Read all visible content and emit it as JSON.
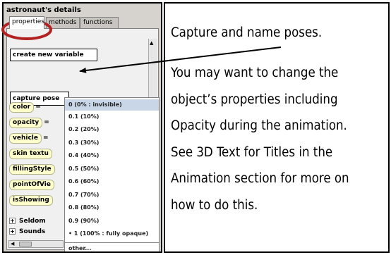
{
  "panel": {
    "title": "astronaut's details",
    "tabs": [
      "properties",
      "methods",
      "functions"
    ],
    "buttons": {
      "new_variable": "create new variable",
      "capture_pose": "capture pose"
    },
    "properties": [
      {
        "name": "color",
        "suffix": "="
      },
      {
        "name": "opacity",
        "suffix": "="
      },
      {
        "name": "vehicle",
        "suffix": "="
      },
      {
        "name": "skin textu",
        "suffix": ""
      },
      {
        "name": "fillingStyle",
        "suffix": ""
      },
      {
        "name": "pointOfVie",
        "suffix": ""
      },
      {
        "name": "isShowing",
        "suffix": ""
      }
    ],
    "tree": [
      {
        "symbol": "+",
        "label": "Seldom"
      },
      {
        "symbol": "+",
        "label": "Sounds"
      }
    ]
  },
  "dropdown": {
    "options": [
      "0 (0% : invisible)",
      "0.1 (10%)",
      "0.2 (20%)",
      "0.3 (30%)",
      "0.4 (40%)",
      "0.5 (50%)",
      "0.6 (60%)",
      "0.7 (70%)",
      "0.8 (80%)",
      "0.9 (90%)",
      "• 1 (100% : fully opaque)"
    ],
    "other": "other...",
    "selected_index": 0
  },
  "note": {
    "lines": [
      "Capture and name poses.",
      "You  may want to change the",
      "object’s properties including",
      "Opacity during the animation.",
      "See 3D Text for Titles in the",
      "Animation section for more on",
      "how to do this."
    ]
  },
  "colors": {
    "annotation_circle": "#b22222",
    "arrow": "#000000"
  }
}
